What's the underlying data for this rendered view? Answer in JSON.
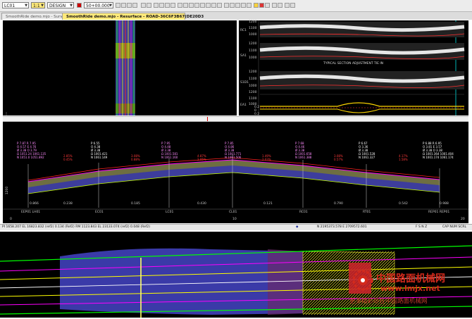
{
  "toolbar": {
    "layer_select": "LC01",
    "ratio_select": "1:1",
    "view_select": "DESIGN",
    "chainage_select": "50+00.000"
  },
  "tabs": [
    {
      "label": "SmoothRide demo.mjo - Survey"
    },
    {
      "label": "SmoothRide demo.mjo - Resurface - ROAD-36C6F3B67(DE20D3"
    }
  ],
  "top_right": {
    "row_labels": [
      "RC1",
      "SA1",
      "S1D1",
      "EA1"
    ],
    "axis_ticks": [
      "1200",
      "1100",
      "1000",
      "1200",
      "1100",
      "1000",
      "1200",
      "1100",
      "1000",
      "1200",
      "1100",
      "1000"
    ],
    "mid_annotation": "TYPICAL SECTION   ADJUSTMENT   TIE IN",
    "bottom_ticks": [
      "0.2",
      "0",
      "0.2"
    ]
  },
  "profile": {
    "left_label": "1200",
    "station_labels": [
      "EEP01 LH01",
      "EC01",
      "LC01",
      "CL01",
      "RC01",
      "RT01",
      "REP01 REP01"
    ],
    "offset_labels": [
      "0.866",
      "0.238",
      "0.185",
      "0.430",
      "0.121",
      "0.790",
      "0.542",
      "0.988"
    ],
    "scale_ticks": [
      "0",
      "10",
      "20"
    ],
    "annotation_columns": [
      {
        "lines": [
          "P 7.87  R 7.95",
          "O 4.57  E 4.76",
          "Ø 3.38  O 3.79",
          "Ω 1051.24  1061.135",
          "N 1051.0  1051.892"
        ]
      },
      {
        "lines": [
          "P 6.55",
          "O 4.38",
          "Ø 3.38",
          "Ω 1001.421",
          "N 1061.149"
        ]
      },
      {
        "lines": [
          "P 7.95",
          "O 4.48",
          "Ø 3.38",
          "Ω 1001.581",
          "N 1061.160"
        ]
      },
      {
        "lines": [
          "P 7.85",
          "O 4.86",
          "Ø 3.38",
          "Ω 1001.771",
          "N 1061.506"
        ]
      },
      {
        "lines": [
          "P 7.68",
          "O 4.46",
          "Ø 3.38",
          "Ω 1001.658",
          "N 1061.388"
        ]
      },
      {
        "lines": [
          "P 6.67",
          "O 3.36",
          "Ø 3.38",
          "Ω 1001.528",
          "N 1061.327"
        ]
      },
      {
        "lines": [
          "P 6.88  R 6.95",
          "O 3.81  E 3.57",
          "Ø 3.38  O 3.38",
          "Ω 1001.364  1001.404",
          "N 1001.174  1061.174"
        ]
      }
    ],
    "slope_labels": [
      {
        "top": "2.85%",
        "bottom": "0.45%"
      },
      {
        "top": "3.08%",
        "bottom": "0.88%"
      },
      {
        "top": "4.87%",
        "bottom": "2.05%"
      },
      {
        "top": "1.49%",
        "bottom": "2.03%"
      },
      {
        "top": "3.08%",
        "bottom": "0.57%"
      },
      {
        "top": "4.17%",
        "bottom": "1.58%"
      }
    ]
  },
  "statusbar": {
    "left_text": "PI 1658.207 EL 16823.832 (ref2) 0.134 (Ref2)   RM 1123.843 EL 23133.074 (ref2) 0.048 (Ref2)",
    "coords_text": "N 2195373.578   E 2709572.601",
    "mode_text": "F S N Z",
    "right_text": "CAP  NUM  SCRL"
  },
  "watermark": {
    "cn_title": "中国路面机械网",
    "url": "www.lmjx.net",
    "cn_sub": "更多精彩尽在中国路面机械网"
  },
  "colors": {
    "panel_bg": "#000000",
    "magenta": "#ff00ff",
    "yellow": "#ffff00",
    "cyan": "#00ffff",
    "green": "#00ff00",
    "red": "#ff2020",
    "profile_fill": "#3d3d9c",
    "watermark_red": "#d42a1c",
    "tab_active": "#ffe97a"
  }
}
